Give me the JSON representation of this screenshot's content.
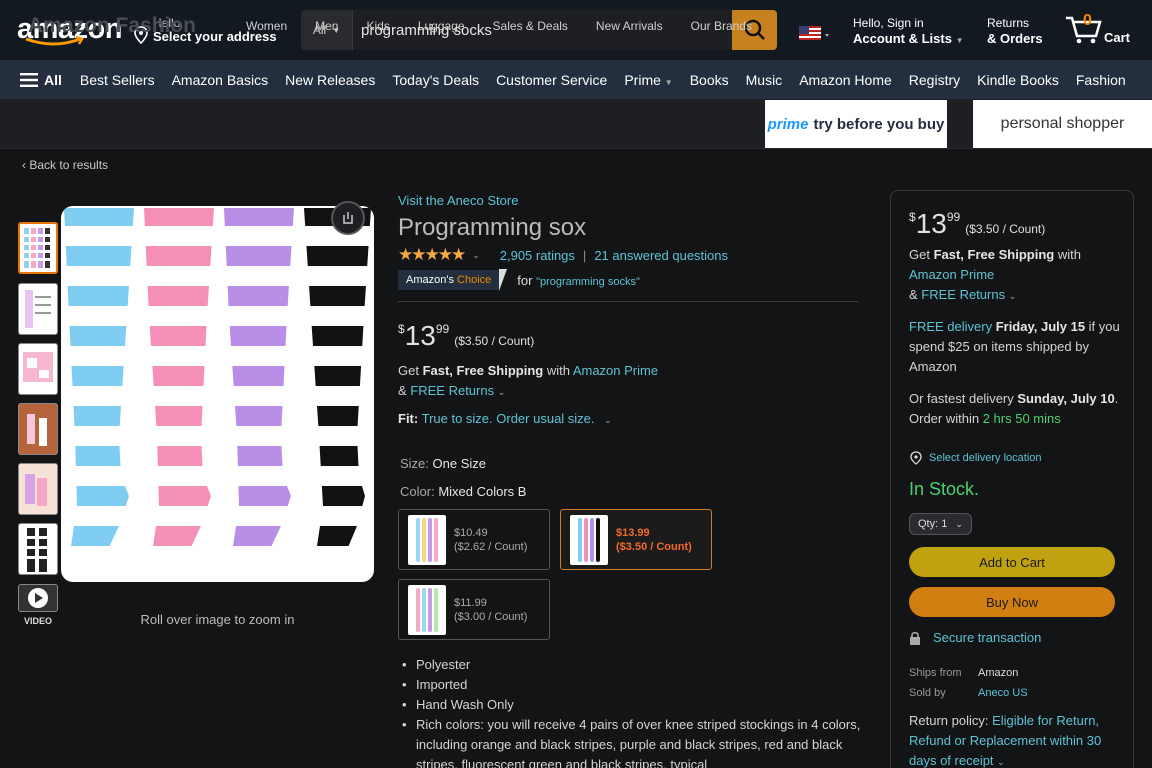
{
  "header": {
    "logo": "amazon",
    "address": {
      "line1": "Hello",
      "line2": "Select your address"
    },
    "search": {
      "category": "All",
      "value": "programming socks"
    },
    "account": {
      "line1": "Hello, Sign in",
      "line2": "Account & Lists"
    },
    "returns": {
      "line1": "Returns",
      "line2": "& Orders"
    },
    "cart": {
      "count": "0",
      "label": "Cart"
    }
  },
  "nav": {
    "all": "All",
    "items": [
      "Best Sellers",
      "Amazon Basics",
      "New Releases",
      "Today's Deals",
      "Customer Service",
      "Prime",
      "Books",
      "Music",
      "Amazon Home",
      "Registry",
      "Kindle Books",
      "Fashion"
    ]
  },
  "fashion": {
    "title": "Amazon Fashion",
    "links": [
      "Women",
      "Men",
      "Kids",
      "Luggage",
      "Sales & Deals",
      "New Arrivals",
      "Our Brands"
    ],
    "prime_banner": {
      "prime": "prime",
      "text": "try before you buy"
    },
    "personal_shopper": "personal shopper"
  },
  "left": {
    "back": "Back to results",
    "video_label": "VIDEO",
    "zoom_hint": "Roll over image to zoom in"
  },
  "product": {
    "store_link": "Visit the Aneco Store",
    "title": "Programming sox",
    "ratings": "2,905 ratings",
    "questions": "21 answered questions",
    "choice": {
      "a": "Amazon's",
      "b": "Choice",
      "for": "for",
      "query": "\"programming socks\""
    },
    "price": {
      "symbol": "$",
      "whole": "13",
      "fraction": "99",
      "unit": "($3.50 / Count)"
    },
    "shipping": {
      "pre": "Get ",
      "bold": "Fast, Free Shipping",
      "mid": " with ",
      "link": "Amazon Prime",
      "amp": "& ",
      "returns": "FREE Returns"
    },
    "fit": {
      "label": "Fit:",
      "value": "True to size. Order usual size."
    },
    "size": {
      "label": "Size:",
      "value": "One Size"
    },
    "color": {
      "label": "Color:",
      "value": "Mixed Colors B"
    },
    "swatches": [
      {
        "price": "$10.49",
        "unit": "($2.62 / Count)"
      },
      {
        "price": "$13.99",
        "unit": "($3.50 / Count)"
      },
      {
        "price": "$11.99",
        "unit": "($3.00 / Count)"
      }
    ],
    "bullets": [
      "Polyester",
      "Imported",
      "Hand Wash Only",
      "Rich colors: you will receive 4 pairs of over knee striped stockings in 4 colors, including orange and black stripes, purple and black stripes, red and black stripes, fluorescent green and black stripes, typical"
    ]
  },
  "buybox": {
    "price": {
      "symbol": "$",
      "whole": "13",
      "fraction": "99",
      "unit": "($3.50 / Count)"
    },
    "shipping": {
      "pre": "Get ",
      "bold": "Fast, Free Shipping",
      "mid": " with",
      "link": "Amazon Prime",
      "amp": "& ",
      "returns": "FREE Returns"
    },
    "delivery": {
      "link": "FREE delivery",
      "date": " Friday, July 15",
      "rest": " if you spend $25 on items shipped by Amazon"
    },
    "fastest": {
      "pre": "Or fastest delivery ",
      "date": "Sunday, July 10",
      "mid": ". Order within ",
      "time": "2 hrs 50 mins"
    },
    "location": "Select delivery location",
    "stock": "In Stock.",
    "qty": "Qty: 1",
    "add_to_cart": "Add to Cart",
    "buy_now": "Buy Now",
    "secure": "Secure transaction",
    "ships_from": {
      "label": "Ships from",
      "value": "Amazon"
    },
    "sold_by": {
      "label": "Sold by",
      "value": "Aneco US"
    },
    "return_policy": {
      "label": "Return policy:",
      "link": "Eligible for Return, Refund or Replacement within 30 days of receipt"
    }
  },
  "colors": {
    "accent": "#febd69",
    "link": "#5fc3d4",
    "stock": "#4dd06e",
    "add_cart": "#c0a10f",
    "buy_now": "#d27f12"
  }
}
